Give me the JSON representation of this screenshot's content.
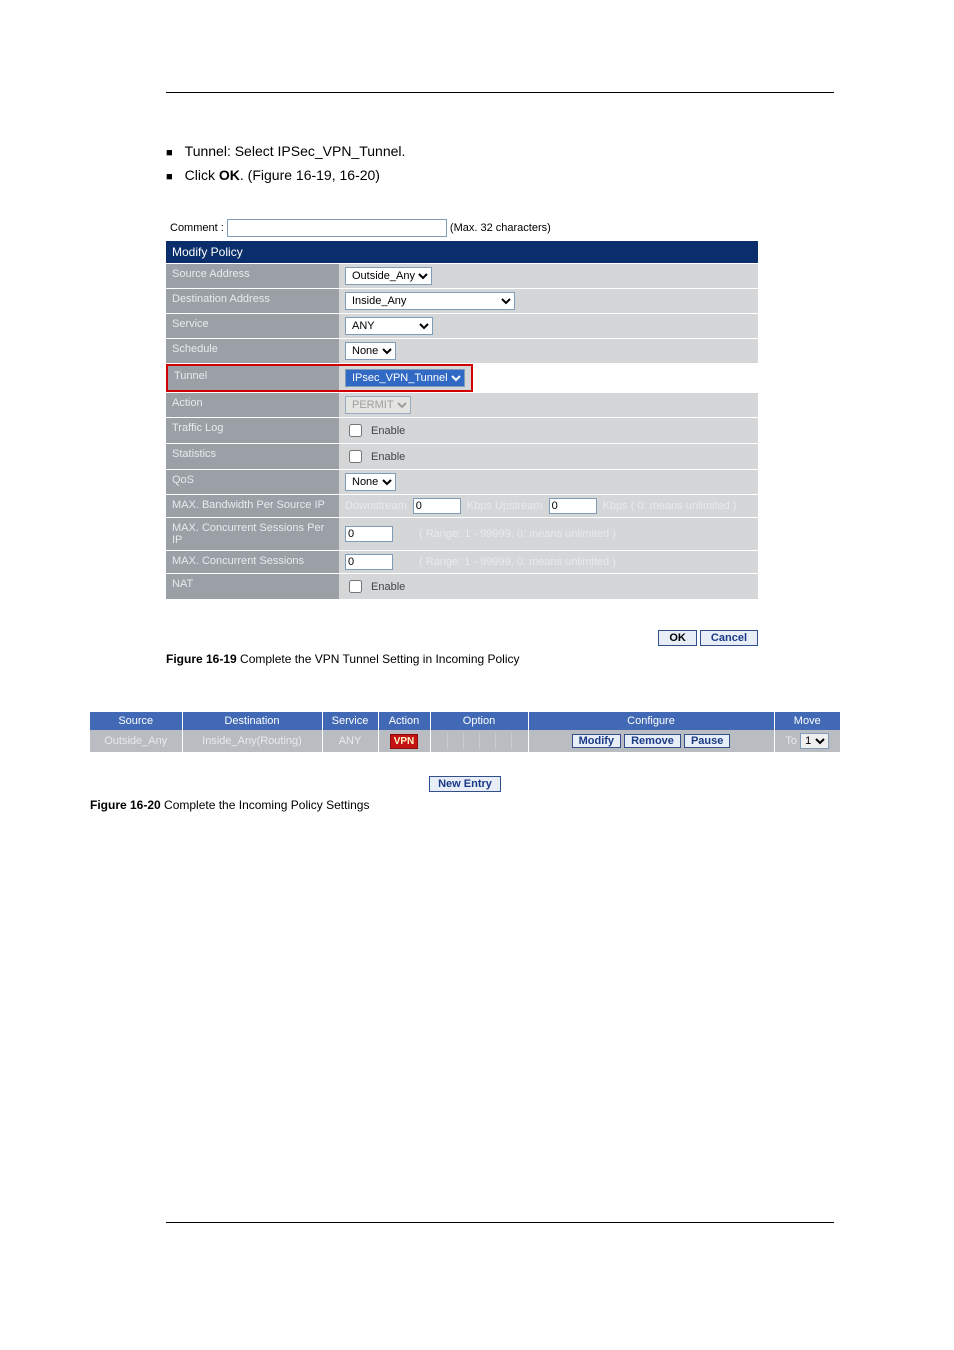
{
  "bullets": {
    "b1_pre": "Tunnel: Select IPSec_VPN_Tunnel.",
    "b2_pre": "Click ",
    "b2_btn": "OK",
    "b2_post": ".",
    "fig_ref": "(Figure 16-19, 16-20)"
  },
  "form": {
    "comment_label": "Comment :",
    "comment_hint": "(Max. 32 characters)",
    "title": "Modify Policy",
    "rows": {
      "source": {
        "label": "Source Address",
        "value": "Outside_Any"
      },
      "dest": {
        "label": "Destination Address",
        "value": "Inside_Any"
      },
      "service": {
        "label": "Service",
        "value": "ANY"
      },
      "schedule": {
        "label": "Schedule",
        "value": "None"
      },
      "tunnel": {
        "label": "Tunnel",
        "value": "IPsec_VPN_Tunnel"
      },
      "action": {
        "label": "Action",
        "value": "PERMIT"
      },
      "traffic": {
        "label": "Traffic Log",
        "enable": "Enable"
      },
      "stats": {
        "label": "Statistics",
        "enable": "Enable"
      },
      "qos": {
        "label": "QoS",
        "value": "None"
      },
      "max_bw": {
        "label": "MAX. Bandwidth Per Source IP",
        "down_label": "Downstream",
        "down_val": "0",
        "up_label": "Kbps Upstream",
        "up_val": "0",
        "tail": "Kbps ( 0: means unlimited )"
      },
      "max_sess_ip": {
        "label": "MAX. Concurrent Sessions Per IP",
        "val": "0",
        "hint": "( Range: 1 - 99999, 0: means unlimited )"
      },
      "max_sess": {
        "label": "MAX. Concurrent Sessions",
        "val": "0",
        "hint": "( Range: 1 - 99999, 0: means unlimited )"
      },
      "nat": {
        "label": "NAT",
        "enable": "Enable"
      }
    },
    "ok": "OK",
    "cancel": "Cancel"
  },
  "fig1_caption_prefix": "Figure 16-19 ",
  "fig1_caption": "Complete the VPN Tunnel Setting in Incoming Policy",
  "policy_table": {
    "headers": {
      "source": "Source",
      "dest": "Destination",
      "service": "Service",
      "action": "Action",
      "option": "Option",
      "configure": "Configure",
      "move": "Move"
    },
    "row": {
      "source": "Outside_Any",
      "dest": "Inside_Any(Routing)",
      "service": "ANY",
      "action_badge": "VPN",
      "modify": "Modify",
      "remove": "Remove",
      "pause": "Pause",
      "move_to": "To",
      "move_val": "1"
    },
    "new_entry": "New Entry"
  },
  "fig2_caption_prefix": "Figure 16-20 ",
  "fig2_caption": "Complete the Incoming Policy Settings"
}
